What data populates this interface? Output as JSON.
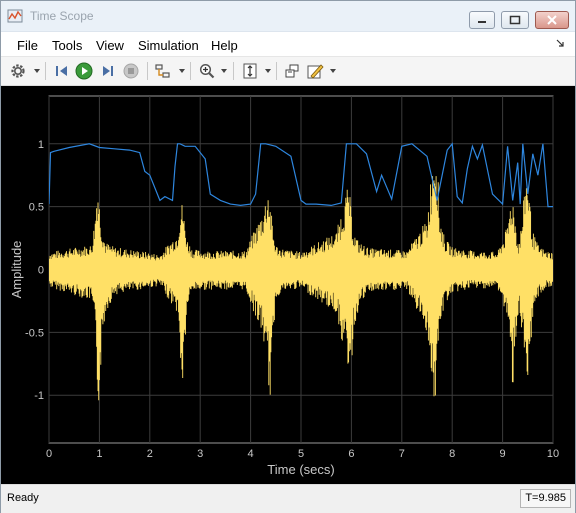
{
  "window": {
    "title": "Time Scope",
    "icon": "matlab-scope-icon"
  },
  "window_controls": [
    "minimize",
    "maximize",
    "close"
  ],
  "menu": {
    "items": [
      "File",
      "Tools",
      "View",
      "Simulation",
      "Help"
    ]
  },
  "toolbar": {
    "buttons": [
      "settings-icon",
      "step-back-icon",
      "run-icon",
      "step-forward-icon",
      "stop-icon",
      "signal-select-icon",
      "zoom-in-icon",
      "scale-axes-icon",
      "restore-layout-icon",
      "style-icon"
    ]
  },
  "chart_data": {
    "type": "line",
    "xlabel": "Time (secs)",
    "ylabel": "Amplitude",
    "xlim": [
      0,
      10
    ],
    "ylim": [
      -1.38,
      1.38
    ],
    "x_ticks": [
      "0",
      "1",
      "2",
      "3",
      "4",
      "5",
      "6",
      "7",
      "8",
      "9",
      "10"
    ],
    "y_ticks": [
      "-1",
      "-0.5",
      "0",
      "0.5",
      "1"
    ],
    "grid": true,
    "background": "#000000",
    "series": [
      {
        "color": "#2e86de",
        "x": [
          0.0,
          0.03,
          0.1,
          0.4,
          0.8,
          1.0,
          1.3,
          1.6,
          1.8,
          1.9,
          2.0,
          2.2,
          2.3,
          2.45,
          2.5,
          2.55,
          2.6,
          2.7,
          2.9,
          3.1,
          3.2,
          3.4,
          3.6,
          3.8,
          4.0,
          4.1,
          4.2,
          4.3,
          4.5,
          4.8,
          5.0,
          5.1,
          5.3,
          5.6,
          5.8,
          5.9,
          6.1,
          6.3,
          6.5,
          6.6,
          6.8,
          7.0,
          7.2,
          7.5,
          7.7,
          7.9,
          8.0,
          8.1,
          8.2,
          8.3,
          8.4,
          8.5,
          8.6,
          8.8,
          9.0,
          9.1,
          9.2,
          9.3,
          9.35,
          9.4,
          9.5,
          9.6,
          9.7,
          9.8,
          9.9,
          10.0
        ],
        "y": [
          0.52,
          0.93,
          0.94,
          0.97,
          1.0,
          0.97,
          0.96,
          0.95,
          0.93,
          0.78,
          0.75,
          0.55,
          0.58,
          0.55,
          0.82,
          1.0,
          1.0,
          0.98,
          0.98,
          0.88,
          0.6,
          0.55,
          0.52,
          0.51,
          0.52,
          0.6,
          1.0,
          1.0,
          0.98,
          0.9,
          0.55,
          0.52,
          0.52,
          0.51,
          0.53,
          1.0,
          1.0,
          0.92,
          0.62,
          0.75,
          0.56,
          0.98,
          1.0,
          0.9,
          0.55,
          0.95,
          1.0,
          0.58,
          0.53,
          0.8,
          0.98,
          0.88,
          0.99,
          0.6,
          0.52,
          0.98,
          0.55,
          0.85,
          0.52,
          1.0,
          0.6,
          0.92,
          0.75,
          1.0,
          0.5,
          0.5
        ]
      },
      {
        "color": "#ffe066",
        "x": [
          0.0,
          0.85,
          0.92,
          0.95,
          0.97,
          1.0,
          1.05,
          1.12,
          1.3,
          1.8,
          2.2,
          2.55,
          2.6,
          2.65,
          2.7,
          2.75,
          2.85,
          3.2,
          3.9,
          4.25,
          4.35,
          4.4,
          4.45,
          4.5,
          4.6,
          5.0,
          5.7,
          5.9,
          5.95,
          6.0,
          6.05,
          6.15,
          6.35,
          6.8,
          7.1,
          7.5,
          7.62,
          7.66,
          7.7,
          7.75,
          7.85,
          8.0,
          8.4,
          8.9,
          9.1,
          9.15,
          9.2,
          9.27,
          9.32,
          9.4,
          9.45,
          9.5,
          9.55,
          9.6,
          9.7,
          9.85,
          10.0
        ],
        "y_upper": [
          0.14,
          0.2,
          0.45,
          0.68,
          0.72,
          0.55,
          0.35,
          0.22,
          0.18,
          0.15,
          0.12,
          0.3,
          0.5,
          0.55,
          0.35,
          0.24,
          0.16,
          0.15,
          0.15,
          0.48,
          0.68,
          0.5,
          0.3,
          0.2,
          0.17,
          0.14,
          0.3,
          0.62,
          0.68,
          0.45,
          0.3,
          0.22,
          0.17,
          0.16,
          0.15,
          0.4,
          0.95,
          1.1,
          0.9,
          0.45,
          0.25,
          0.18,
          0.15,
          0.14,
          0.35,
          0.55,
          0.6,
          0.35,
          0.2,
          0.45,
          0.75,
          0.8,
          0.5,
          0.3,
          0.2,
          0.15,
          0.14
        ],
        "y_lower": [
          -0.14,
          -0.25,
          -0.55,
          -0.9,
          -1.1,
          -1.05,
          -0.6,
          -0.35,
          -0.2,
          -0.16,
          -0.13,
          -0.35,
          -0.7,
          -1.0,
          -0.6,
          -0.3,
          -0.17,
          -0.16,
          -0.16,
          -0.55,
          -0.9,
          -1.1,
          -0.55,
          -0.25,
          -0.18,
          -0.15,
          -0.35,
          -0.75,
          -0.8,
          -0.78,
          -0.5,
          -0.3,
          -0.18,
          -0.17,
          -0.16,
          -0.5,
          -1.0,
          -1.1,
          -0.9,
          -0.5,
          -0.28,
          -0.19,
          -0.15,
          -0.15,
          -0.4,
          -0.75,
          -0.95,
          -0.55,
          -0.3,
          -0.6,
          -0.9,
          -1.1,
          -0.75,
          -0.4,
          -0.22,
          -0.16,
          -0.14
        ]
      }
    ]
  },
  "status": {
    "text": "Ready",
    "time": "T=9.985"
  }
}
